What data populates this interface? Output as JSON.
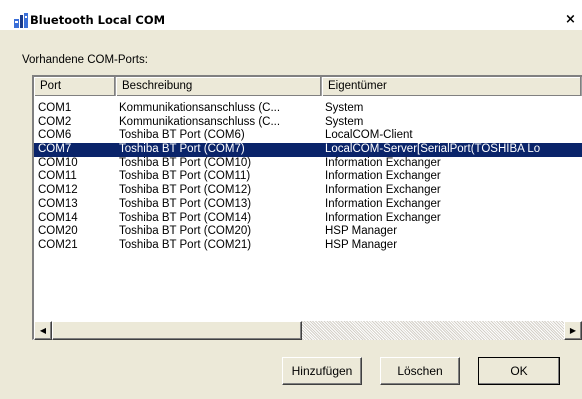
{
  "window": {
    "title": "Bluetooth Local COM",
    "close_label": "×",
    "icon": "bluetooth-com-icon"
  },
  "group": {
    "label": "Vorhandene COM-Ports:"
  },
  "list": {
    "columns": [
      "Port",
      "Beschreibung",
      "Eigentümer"
    ],
    "selected_index": 3,
    "rows": [
      {
        "port": "COM1",
        "desc": "Kommunikationsanschluss (C...",
        "owner": "System"
      },
      {
        "port": "COM2",
        "desc": "Kommunikationsanschluss (C...",
        "owner": "System"
      },
      {
        "port": "COM6",
        "desc": "Toshiba BT Port (COM6)",
        "owner": "LocalCOM-Client"
      },
      {
        "port": "COM7",
        "desc": "Toshiba BT Port (COM7)",
        "owner": "LocalCOM-Server[SerialPort(TOSHIBA Lo"
      },
      {
        "port": "COM10",
        "desc": "Toshiba BT Port (COM10)",
        "owner": "Information Exchanger"
      },
      {
        "port": "COM11",
        "desc": "Toshiba BT Port (COM11)",
        "owner": "Information Exchanger"
      },
      {
        "port": "COM12",
        "desc": "Toshiba BT Port (COM12)",
        "owner": "Information Exchanger"
      },
      {
        "port": "COM13",
        "desc": "Toshiba BT Port (COM13)",
        "owner": "Information Exchanger"
      },
      {
        "port": "COM14",
        "desc": "Toshiba BT Port (COM14)",
        "owner": "Information Exchanger"
      },
      {
        "port": "COM20",
        "desc": "Toshiba BT Port (COM20)",
        "owner": "HSP Manager"
      },
      {
        "port": "COM21",
        "desc": "Toshiba BT Port (COM21)",
        "owner": "HSP Manager"
      }
    ]
  },
  "scrollbar": {
    "left_arrow": "◀",
    "right_arrow": "▶"
  },
  "buttons": {
    "add": "Hinzufügen",
    "delete": "Löschen",
    "ok": "OK"
  },
  "colors": {
    "selection": "#0a246a",
    "face": "#ece9d8"
  }
}
